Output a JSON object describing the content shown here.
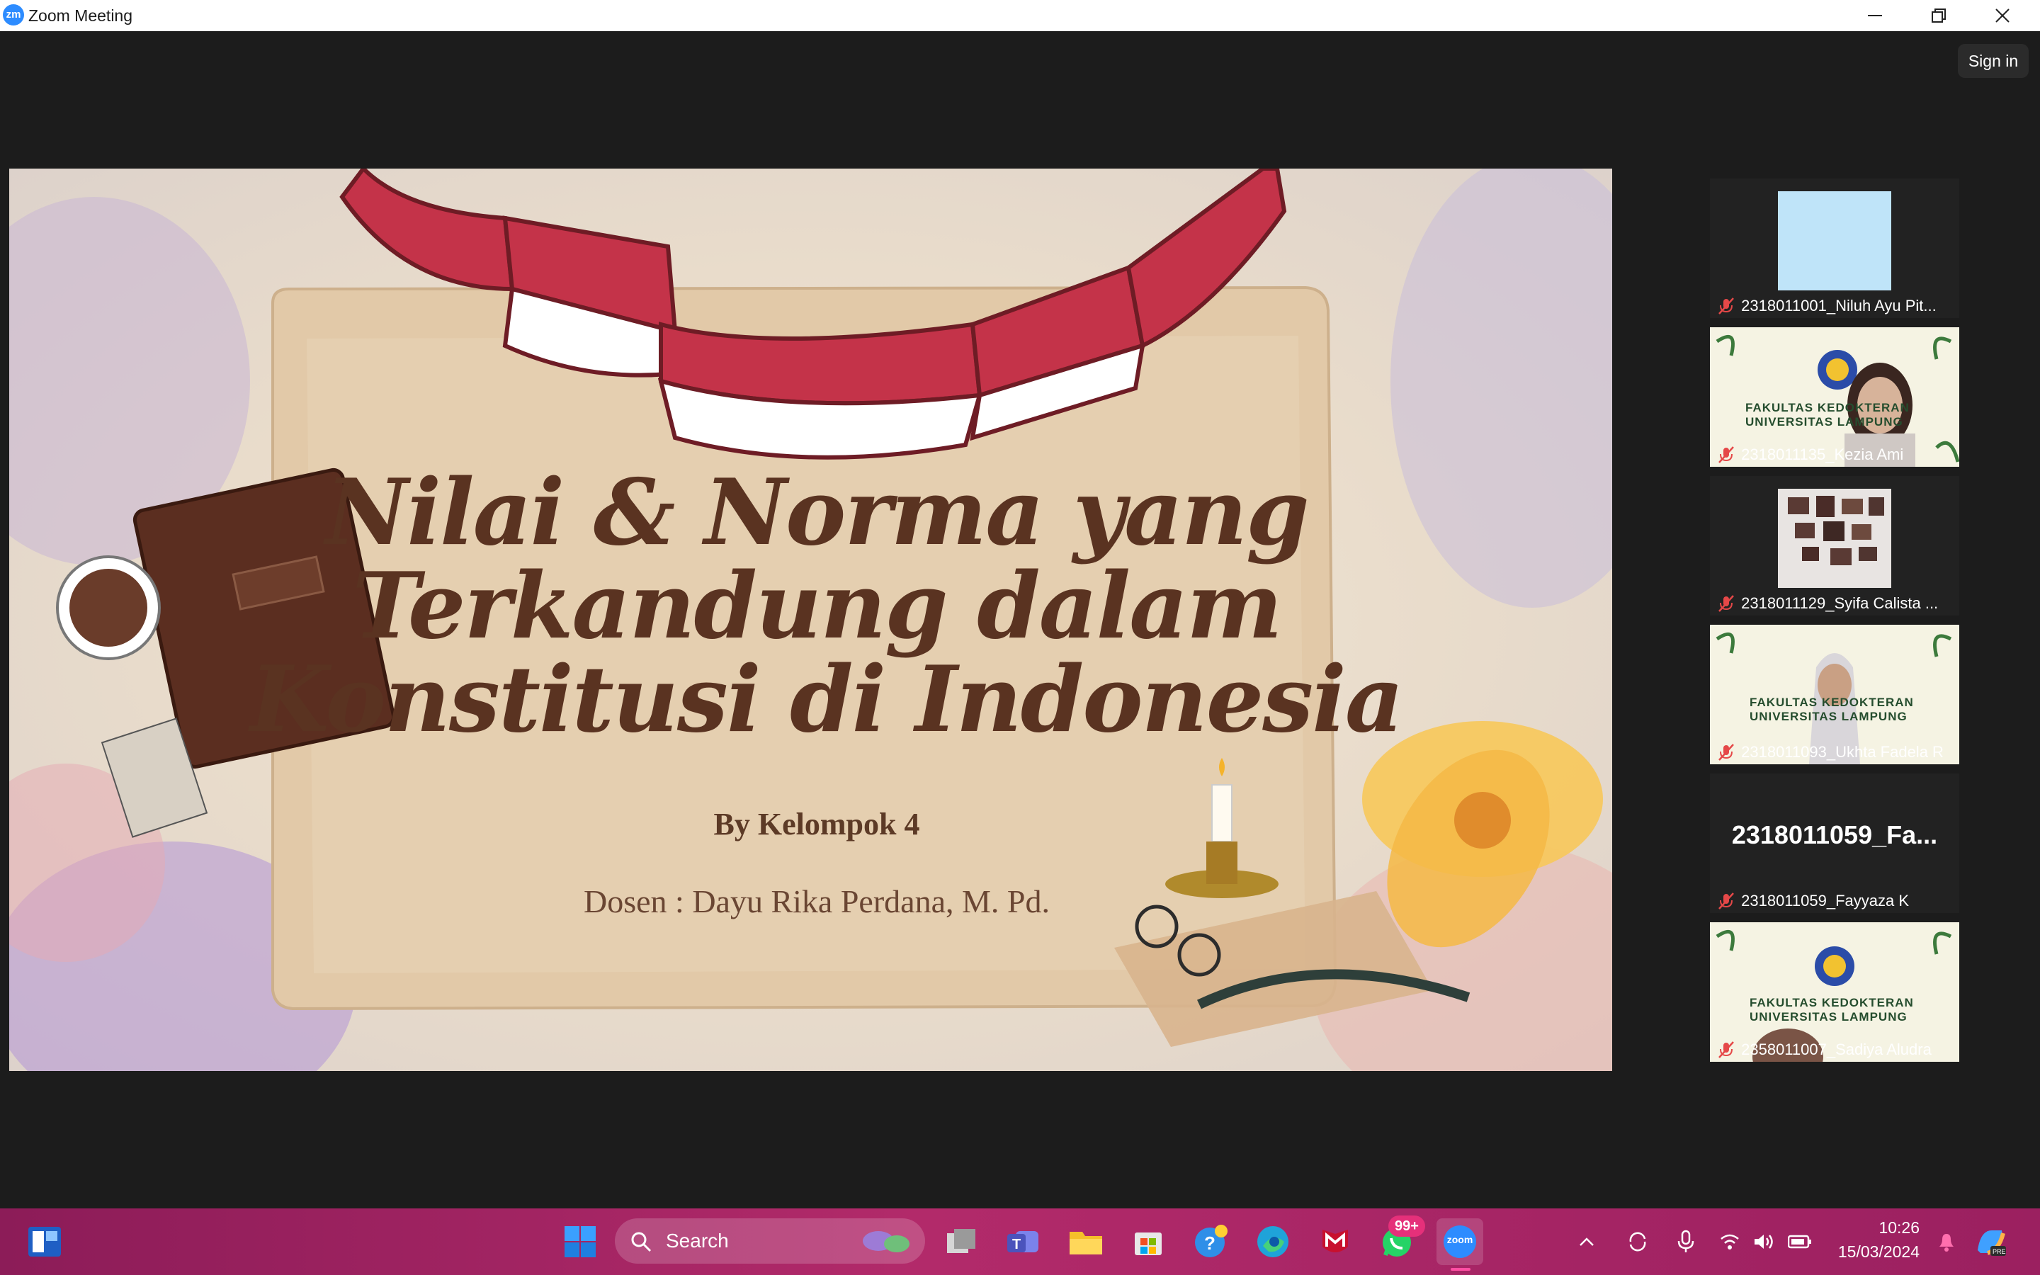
{
  "window": {
    "app_icon_text": "zm",
    "title": "Zoom Meeting",
    "controls": [
      "minimize-icon",
      "restore-icon",
      "close-icon"
    ]
  },
  "header": {
    "sign_in_label": "Sign in"
  },
  "slide": {
    "title_lines": [
      "Nilai & Norma yang",
      "Terkandung dalam",
      "Konstitusi di Indonesia"
    ],
    "byline": "By Kelompok 4",
    "lecturer": "Dosen : Dayu Rika Perdana, M. Pd.",
    "annotation_icon": "pencil-icon"
  },
  "participants": [
    {
      "name": "2318011001_Niluh Ayu Pit...",
      "muted": true,
      "video": "light-blue"
    },
    {
      "name": "2318011135_Kezia Ami",
      "muted": true,
      "video": "camera",
      "banner": [
        "FAKULTAS KEDOKTERAN",
        "UNIVERSITAS LAMPUNG"
      ]
    },
    {
      "name": "2318011129_Syifa Calista ...",
      "muted": true,
      "video": "gallery-wall"
    },
    {
      "name": "2318011093_Ukhta Fadela R",
      "muted": true,
      "video": "camera",
      "banner": [
        "FAKULTAS KEDOKTERAN",
        "UNIVERSITAS LAMPUNG"
      ]
    },
    {
      "name": "2318011059_Fayyaza K",
      "muted": true,
      "video": "off",
      "display_name": "2318011059_Fa..."
    },
    {
      "name": "2358011007_Sadiya Aludra",
      "muted": true,
      "video": "camera",
      "banner": [
        "FAKULTAS KEDOKTERAN",
        "UNIVERSITAS LAMPUNG"
      ]
    }
  ],
  "taskbar": {
    "search_placeholder": "Search",
    "apps": [
      "widgets-icon",
      "windows-start-icon",
      "task-view-icon",
      "teams-icon",
      "file-explorer-icon",
      "microsoft-store-icon",
      "tips-icon",
      "edge-icon",
      "mcafee-icon",
      "whatsapp-icon",
      "zoom-icon"
    ],
    "whatsapp_badge": "99+",
    "zoom_label": "zoom",
    "time": "10:26",
    "date": "15/03/2024",
    "colors": {
      "accent": "#b22a6a",
      "zoom_blue": "#2d8cff"
    }
  }
}
